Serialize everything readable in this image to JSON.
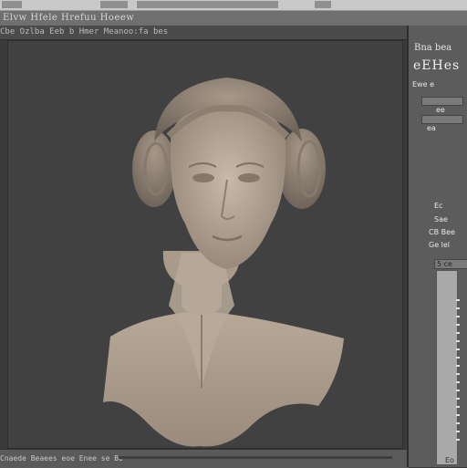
{
  "window": {
    "menu_text": "Elvw  Hfele  Hrefuu   Hoeew",
    "toolbar_text": "Cbe  Ozlba   Eeb   b  Hmer Meanoo:fa  bes"
  },
  "right_panel": {
    "title": "Bna bea",
    "heading": "eEHes",
    "line1": "Ewe  e",
    "line2": "ee",
    "line3": "ea",
    "section": "Ec",
    "label1": "Sae",
    "label2": "CB Bee",
    "label3": "Ge lel",
    "field_label": "5 ce"
  },
  "bottom": {
    "text": "Cnaede  Beaees  eoe   Enee se   Be",
    "right_text": "Eo"
  },
  "colors": {
    "bg": "#3a3a3b",
    "viewport": "#414142",
    "clay": "#b4a596",
    "panel": "#5c5c5d"
  }
}
